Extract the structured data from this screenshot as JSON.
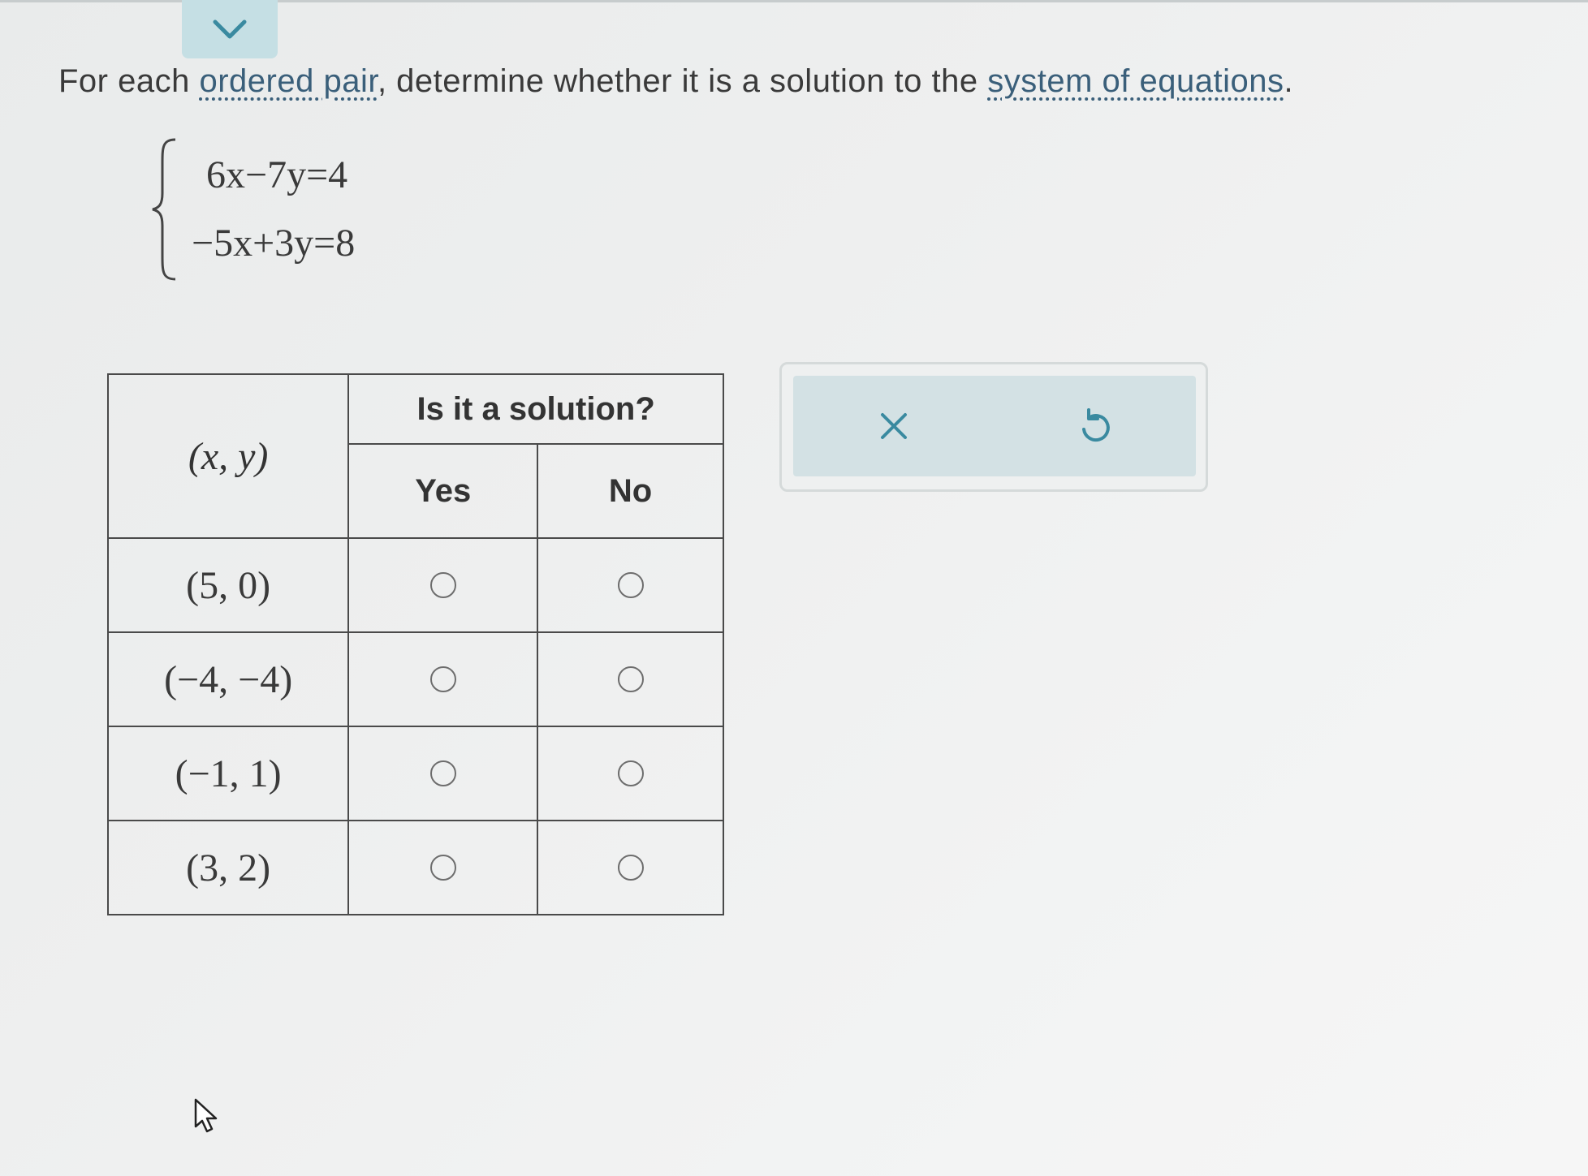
{
  "question": {
    "prefix": "For each ",
    "link1": "ordered pair",
    "middle": ", determine whether it is a solution to the ",
    "link2": "system of equations",
    "suffix": "."
  },
  "system": {
    "eq1": "6x−7y=4",
    "eq2": "−5x+3y=8"
  },
  "table": {
    "col_pair": "(x, y)",
    "col_group": "Is it a solution?",
    "col_yes": "Yes",
    "col_no": "No",
    "rows": [
      {
        "pair": "(5, 0)"
      },
      {
        "pair": "(−4, −4)"
      },
      {
        "pair": "(−1, 1)"
      },
      {
        "pair": "(3, 2)"
      }
    ]
  },
  "icons": {
    "collapse": "chevron-down-icon",
    "clear": "close-icon",
    "undo": "undo-icon"
  },
  "colors": {
    "accent": "#3a8aa0",
    "panel": "#d3e1e4",
    "link": "#3a5f7a"
  }
}
